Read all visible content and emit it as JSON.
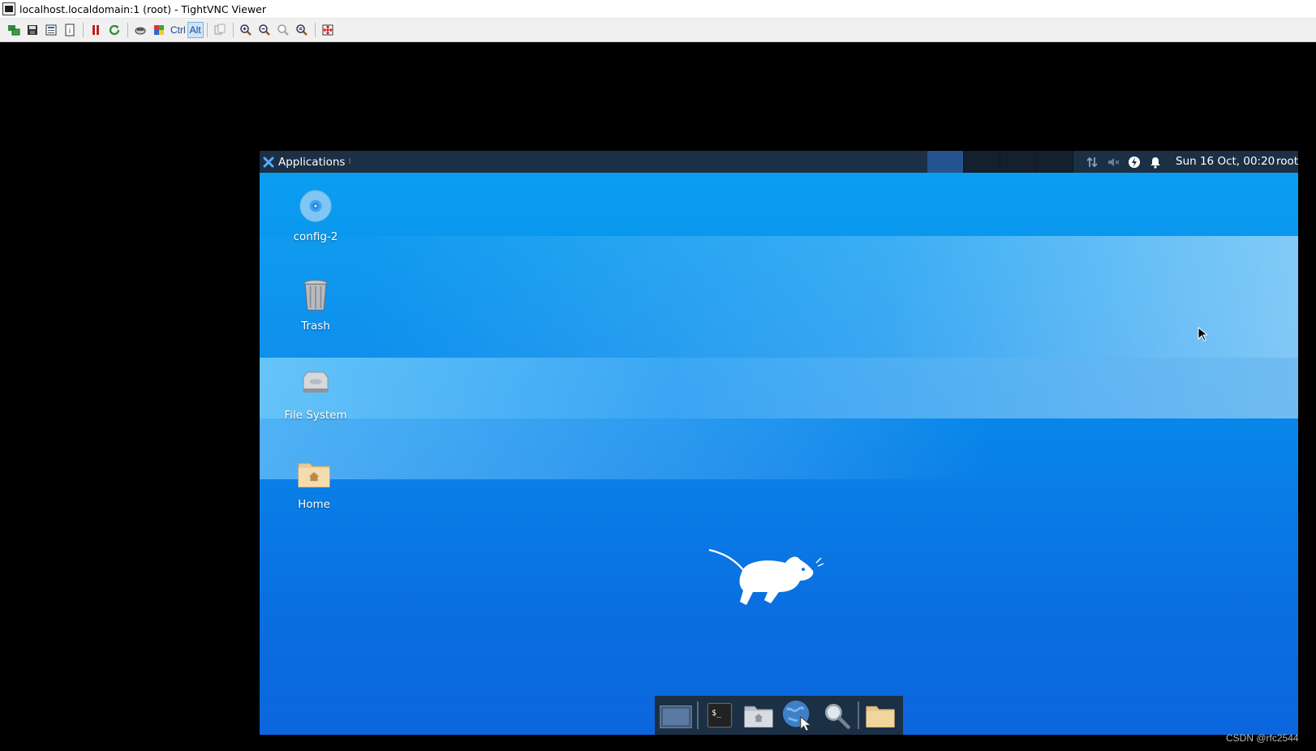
{
  "window": {
    "title": "localhost.localdomain:1 (root) - TightVNC Viewer"
  },
  "toolbar": {
    "buttons": [
      {
        "name": "new-connection-icon"
      },
      {
        "name": "save-icon"
      },
      {
        "name": "options-icon"
      },
      {
        "name": "connection-info-icon"
      },
      {
        "name": "pause-icon"
      },
      {
        "name": "refresh-icon"
      },
      {
        "name": "ctrl-alt-del-icon"
      },
      {
        "name": "ctrl-esc-icon"
      }
    ],
    "ctrl_label": "Ctrl",
    "alt_label": "Alt",
    "zoom_buttons": [
      {
        "name": "zoom-in-icon"
      },
      {
        "name": "zoom-out-icon"
      },
      {
        "name": "zoom-100-icon"
      },
      {
        "name": "zoom-auto-icon"
      }
    ]
  },
  "panel": {
    "applications_label": "Applications",
    "clock": "Sun 16 Oct, 00:20",
    "user": "root",
    "workspaces": 4,
    "active_workspace": 1
  },
  "desktop": {
    "icons": [
      {
        "label": "config-2",
        "icon": "disc-icon"
      },
      {
        "label": "Trash",
        "icon": "trash-icon"
      },
      {
        "label": "File System",
        "icon": "hard-drive-icon"
      },
      {
        "label": "Home",
        "icon": "home-folder-icon"
      }
    ]
  },
  "dock": {
    "items": [
      "show-desktop-icon",
      "terminal-icon",
      "file-manager-icon",
      "web-browser-icon",
      "app-finder-icon",
      "folder-icon"
    ]
  },
  "watermark": "CSDN @rfc2544",
  "colors": {
    "panel": "#1b2f45",
    "desktop_top": "#0aa0f0",
    "desktop_bottom": "#0b66de",
    "active_workspace": "#24538f"
  }
}
